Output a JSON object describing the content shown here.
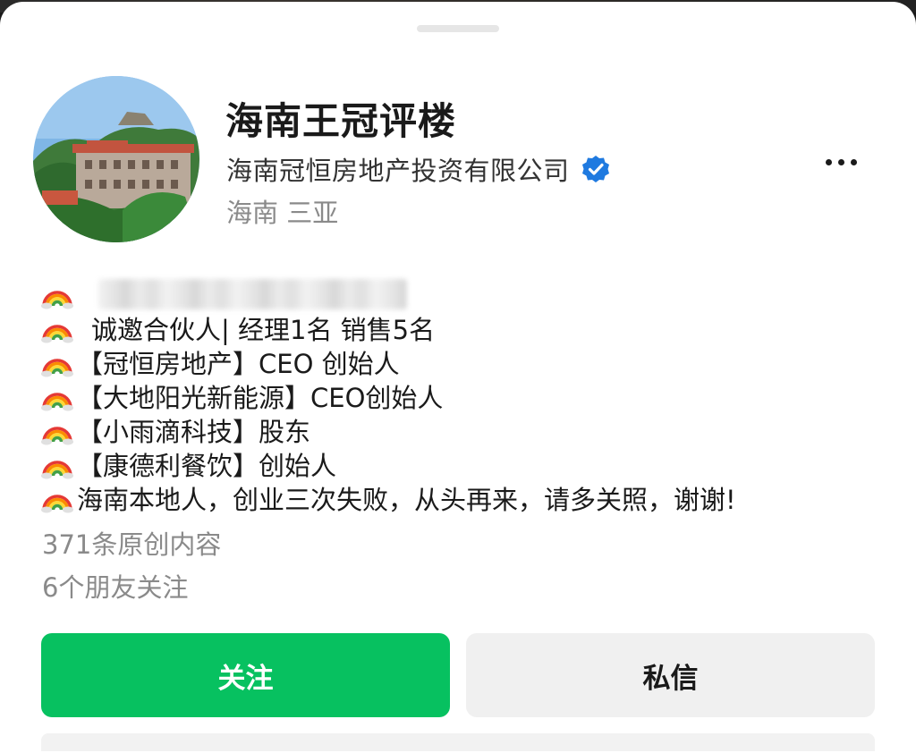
{
  "profile": {
    "name": "海南王冠评楼",
    "company": "海南冠恒房地产投资有限公司",
    "location": "海南 三亚"
  },
  "bio": {
    "lines": [
      "诚邀合伙人| 经理1名 销售5名",
      "【冠恒房地产】CEO 创始人",
      "【大地阳光新能源】CEO创始人",
      "【小雨滴科技】股东",
      "【康德利餐饮】创始人",
      "海南本地人，创业三次失败，从头再来，请多关照，谢谢!"
    ]
  },
  "stats": {
    "original_content": "371条原创内容",
    "friends_following": "6个朋友关注"
  },
  "actions": {
    "follow_label": "关注",
    "message_label": "私信"
  },
  "icons": {
    "verified": "verified-badge-icon",
    "more": "more-dots-icon",
    "bio_bullet": "rainbow-emoji"
  },
  "colors": {
    "accent_green": "#07c160",
    "verified_blue": "#1f7ae0",
    "secondary_text": "#8a8a8a"
  }
}
